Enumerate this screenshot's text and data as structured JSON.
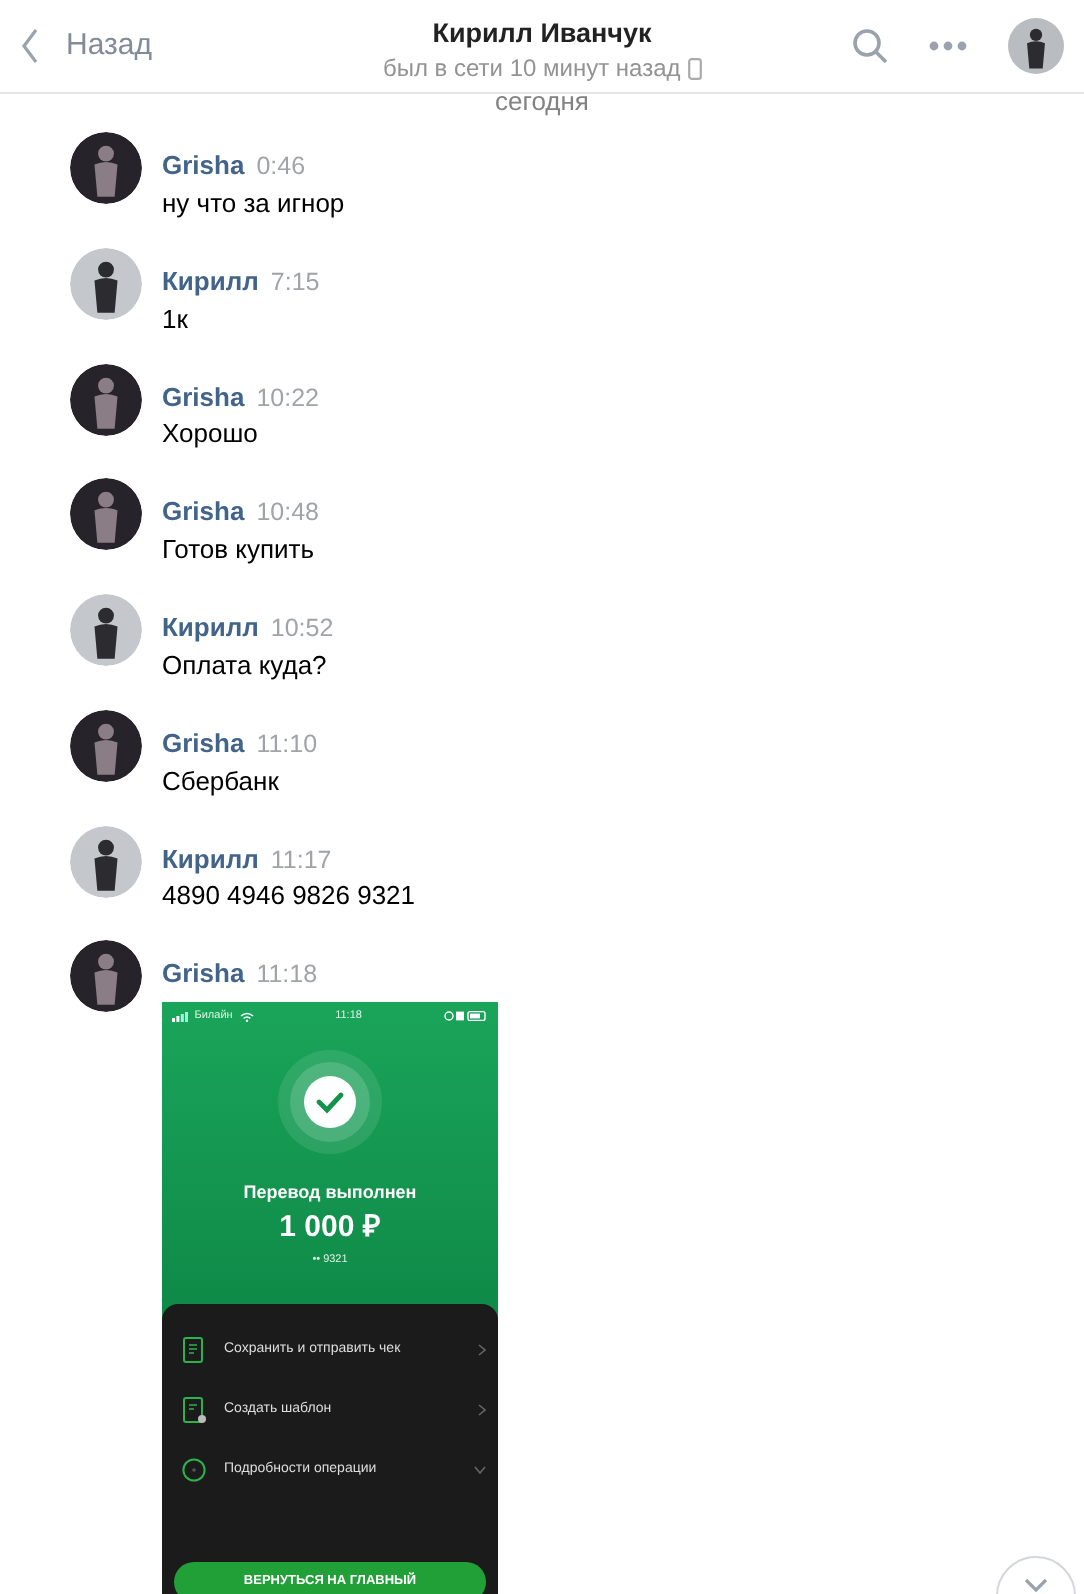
{
  "header": {
    "back_label": "Назад",
    "title": "Кирилл Иванчук",
    "status": "был в сети 10 минут назад"
  },
  "date_label": "сегодня",
  "messages": [
    {
      "author": "Grisha",
      "time": "0:46",
      "color": "#26232b",
      "kind": "text",
      "text": "ну что за игнор"
    },
    {
      "author": "Кирилл",
      "time": "7:15",
      "color": "#c4c7cb",
      "kind": "text",
      "text": "1к"
    },
    {
      "author": "Grisha",
      "time": "10:22",
      "color": "#26232b",
      "kind": "text",
      "text": "Хорошо"
    },
    {
      "author": "Grisha",
      "time": "10:48",
      "color": "#26232b",
      "kind": "text",
      "text": "Готов купить"
    },
    {
      "author": "Кирилл",
      "time": "10:52",
      "color": "#c4c7cb",
      "kind": "text",
      "text": "Оплата куда?"
    },
    {
      "author": "Grisha",
      "time": "11:10",
      "color": "#26232b",
      "kind": "text",
      "text": "Сбербанк"
    },
    {
      "author": "Кирилл",
      "time": "11:17",
      "color": "#c4c7cb",
      "kind": "text",
      "text": "4890 4946 9826 9321"
    },
    {
      "author": "Grisha",
      "time": "11:18",
      "color": "#26232b",
      "kind": "screenshot",
      "screenshot": {
        "carrier": "Билайн",
        "clock": "11:18",
        "title": "Перевод выполнен",
        "amount": "1 000 ₽",
        "card": "•• 9321",
        "actions": [
          {
            "kind": "receipt",
            "label": "Сохранить и отправить чек"
          },
          {
            "kind": "template",
            "label": "Создать шаблон"
          },
          {
            "kind": "info",
            "label": "Подробности операции"
          }
        ],
        "button": "ВЕРНУТЬСЯ НА ГЛАВНЫЙ"
      }
    }
  ]
}
